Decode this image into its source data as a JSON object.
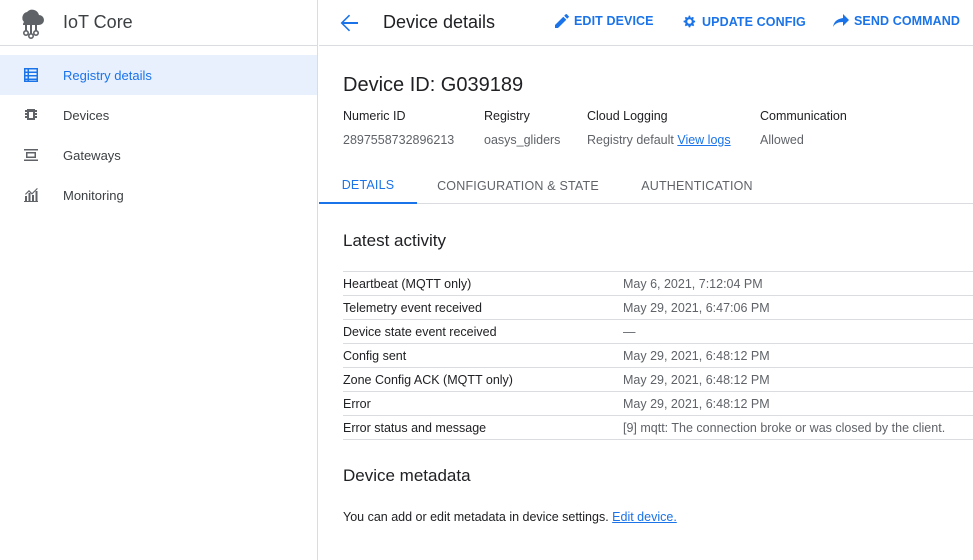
{
  "app": {
    "title": "IoT Core"
  },
  "sidebar": {
    "items": [
      {
        "label": "Registry details",
        "icon": "table-icon",
        "active": true
      },
      {
        "label": "Devices",
        "icon": "chip-icon",
        "active": false
      },
      {
        "label": "Gateways",
        "icon": "gateway-icon",
        "active": false
      },
      {
        "label": "Monitoring",
        "icon": "chart-icon",
        "active": false
      }
    ]
  },
  "header": {
    "title": "Device details",
    "actions": {
      "edit": "EDIT DEVICE",
      "update": "UPDATE CONFIG",
      "send": "SEND COMMAND"
    }
  },
  "device": {
    "id_label": "Device ID: G039189",
    "info": [
      {
        "label": "Numeric ID",
        "value": "2897558732896213"
      },
      {
        "label": "Registry",
        "value": "oasys_gliders"
      },
      {
        "label": "Cloud Logging",
        "value": "Registry default",
        "link": "View logs"
      },
      {
        "label": "Communication",
        "value": "Allowed"
      }
    ]
  },
  "tabs": {
    "details": "DETAILS",
    "config": "CONFIGURATION & STATE",
    "auth": "AUTHENTICATION"
  },
  "activity": {
    "title": "Latest activity",
    "rows": [
      {
        "label": "Heartbeat (MQTT only)",
        "value": "May 6, 2021, 7:12:04 PM"
      },
      {
        "label": "Telemetry event received",
        "value": "May 29, 2021, 6:47:06 PM"
      },
      {
        "label": "Device state event received",
        "value": "—"
      },
      {
        "label": "Config sent",
        "value": "May 29, 2021, 6:48:12 PM"
      },
      {
        "label": "Zone Config ACK (MQTT only)",
        "value": "May 29, 2021, 6:48:12 PM"
      },
      {
        "label": "Error",
        "value": "May 29, 2021, 6:48:12 PM"
      },
      {
        "label": "Error status and message",
        "value": "[9] mqtt: The connection broke or was closed by the client."
      }
    ]
  },
  "metadata": {
    "title": "Device metadata",
    "text": "You can add or edit metadata in device settings.",
    "link": "Edit device."
  },
  "colors": {
    "accent": "#1a73e8",
    "active_bg": "#e8f0fe",
    "divider": "#dadce0"
  }
}
